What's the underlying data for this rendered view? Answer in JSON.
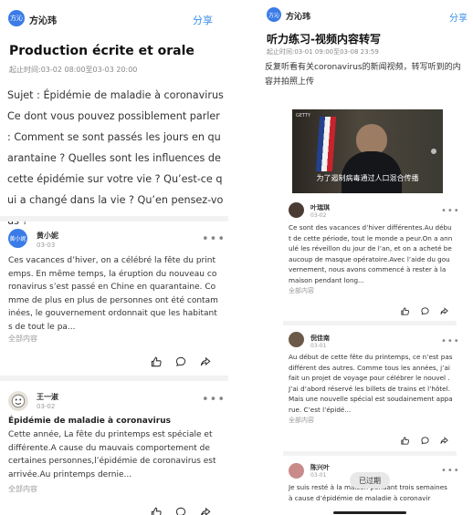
{
  "left": {
    "course": {
      "avatar": "方沁",
      "name": "方沁玮"
    },
    "share": "分享",
    "title": "Production écrite et orale",
    "period": "起止时间:03-02 08:00至03-03 20:00",
    "topic": "Sujet : Épidémie de maladie à coronavirus Ce dont vous pouvez possiblement parler : Comment se sont passés les jours en quarantaine ? Quelles sont les influences de cette épidémie sur votre vie ? Qu’est-ce qui a changé dans la vie ? Qu’en pensez-vous ?",
    "posts": [
      {
        "avatar": "黄小妮",
        "name": "黄小妮",
        "date": "03-03",
        "title": "",
        "body": "Ces vacances d’hiver, on a célébré la fête du printemps. En même temps, la éruption du nouveau coronavirus s’est passé en Chine en quarantaine. Comme de plus en plus de personnes ont été contaminées, le gouvernement ordonnait que les habitants de tout le pa...",
        "more": "全部内容"
      },
      {
        "avatar": "",
        "name": "王一淑",
        "date": "03-02",
        "title": "Épidémie de maladie à coronavirus",
        "body": "Cette année, La fête du printemps est spéciale et différente.A cause du mauvais comportement de certaines personnes,l’épidémie de coronavirus est arrivée.Au printemps dernie...",
        "more": "全部内容"
      }
    ]
  },
  "right": {
    "course": {
      "avatar": "方沁",
      "name": "方沁玮"
    },
    "share": "分享",
    "title": "听力练习-视频内容转写",
    "period": "起止时间:03-01 09:00至03-08 23:59",
    "desc": "反复听看有关coronavirus的新闻视频，转写听到的内容并拍照上传",
    "video": {
      "subtitle": "为了遏制病毒通过人口混合传播",
      "logo": "GETTY"
    },
    "posts": [
      {
        "name": "叶瑞琪",
        "date": "03-02",
        "body": "Ce sont des vacances d’hiver différentes.Au début de cette période, tout le monde a peur.On a annulé les réveillon du jour de l’an, et on a acheté beaucoup de masque opératoire.Avec l’aide du gouvernement, nous avons commencé à rester à la maison pendant long...",
        "more": "全部内容"
      },
      {
        "name": "倪佳南",
        "date": "03-01",
        "body": "Au début de cette fête du printemps, ce n’est pas différent des autres. Comme tous les années, j’ai fait un projet de voyage pour célébrer le nouvel . J’ai d’abord réservé les billets de trains et l’hôtel. Mais une nouvelle spécial est soudainement apparue. C’est l’épidé...",
        "more": "全部内容"
      },
      {
        "name": "陈兴叶",
        "date": "03-01",
        "body": "Je suis resté à la maison pendant trois semaines à cause d’épidémie de maladie à coronavir",
        "more": ""
      }
    ],
    "expired_badge": "已过期"
  }
}
